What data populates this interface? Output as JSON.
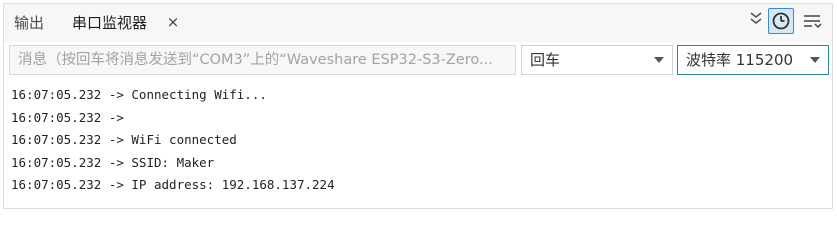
{
  "tabs": {
    "output_label": "输出",
    "monitor_label": "串口监视器",
    "close_glyph": "×"
  },
  "toolbar": {
    "message_placeholder": "消息（按回车将消息发送到“COM3”上的“Waveshare ESP32-S3-Zero...",
    "line_ending": "回车",
    "baud_rate": "波特率 115200"
  },
  "icons": {
    "collapse": "chevron-double-down-icon",
    "timestamp": "clock-icon",
    "autoscroll": "autoscroll-lines-icon"
  },
  "colors": {
    "accent": "#3c8ad0",
    "baud_border": "#2b8a8f"
  },
  "output": {
    "lines": [
      "16:07:05.232 -> Connecting Wifi...",
      "16:07:05.232 ->",
      "16:07:05.232 -> WiFi connected",
      "16:07:05.232 -> SSID: Maker",
      "16:07:05.232 -> IP address: 192.168.137.224"
    ]
  }
}
